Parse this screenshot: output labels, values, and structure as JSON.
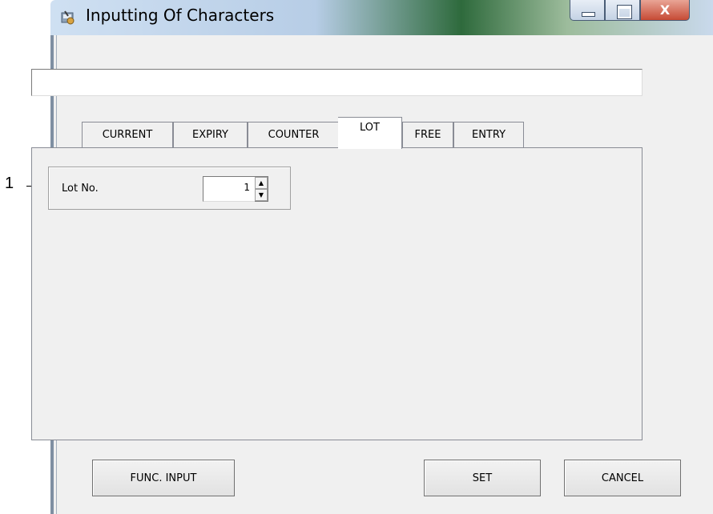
{
  "callout": {
    "number": "1"
  },
  "window": {
    "title": "Inputting Of Characters",
    "minimize_glyph": "",
    "maximize_glyph": "",
    "close_glyph": "X"
  },
  "text_entry": {
    "value": ""
  },
  "tabs": [
    {
      "label": "CURRENT",
      "active": false
    },
    {
      "label": "EXPIRY",
      "active": false
    },
    {
      "label": "COUNTER",
      "active": false
    },
    {
      "label": "LOT",
      "active": true
    },
    {
      "label": "FREE",
      "active": false
    },
    {
      "label": "ENTRY",
      "active": false
    }
  ],
  "lot_panel": {
    "label": "Lot No.",
    "value": "1",
    "spin_up_glyph": "▲",
    "spin_down_glyph": "▼"
  },
  "buttons": {
    "func_input": "FUNC. INPUT",
    "set": "SET",
    "cancel": "CANCEL"
  },
  "icons": {
    "app": "app-icon",
    "minimize": "minimize-icon",
    "maximize": "maximize-icon",
    "close": "close-icon",
    "spin_up": "spin-up-icon",
    "spin_down": "spin-down-icon"
  }
}
